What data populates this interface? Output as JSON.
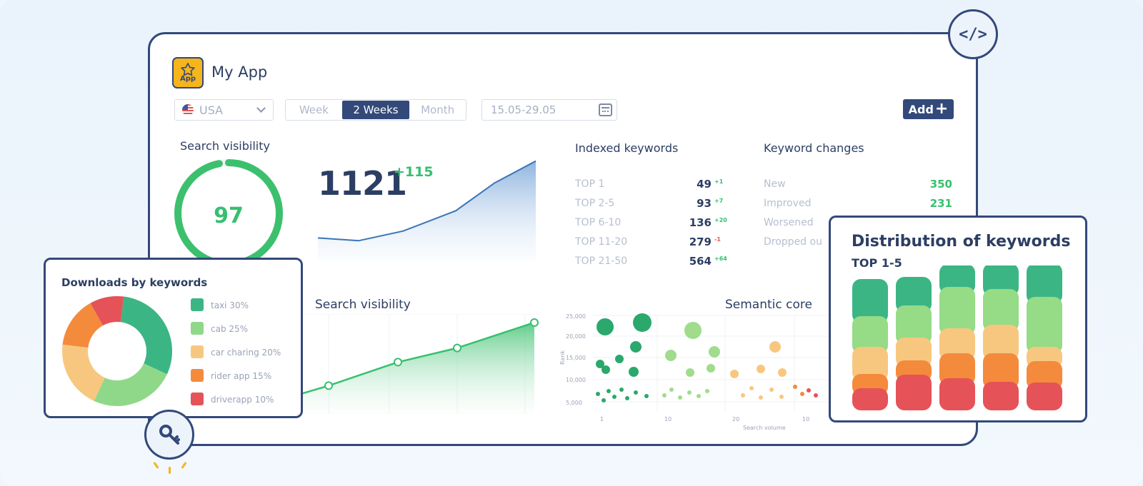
{
  "app": {
    "name": "My App",
    "icon_tag": "App",
    "icon": "star-icon"
  },
  "filters": {
    "country": "USA",
    "periods": [
      "Week",
      "2 Weeks",
      "Month"
    ],
    "active_period": "2 Weeks",
    "date_range": "15.05-29.05",
    "add_label": "Add"
  },
  "search_visibility": {
    "title": "Search visibility",
    "score": "97",
    "score_fraction": 0.97,
    "total": "1121",
    "delta": "+115",
    "trend": [
      40,
      35,
      52,
      68,
      88,
      137,
      176
    ]
  },
  "indexed_keywords": {
    "title": "Indexed keywords",
    "rows": [
      {
        "label": "TOP 1",
        "value": "49",
        "delta": "+1",
        "delta_color": "#36c06f"
      },
      {
        "label": "TOP 2-5",
        "value": "93",
        "delta": "+7",
        "delta_color": "#36c06f"
      },
      {
        "label": "TOP 6-10",
        "value": "136",
        "delta": "+20",
        "delta_color": "#36c06f"
      },
      {
        "label": "TOP 11-20",
        "value": "279",
        "delta": "-1",
        "delta_color": "#ef5350"
      },
      {
        "label": "TOP 21-50",
        "value": "564",
        "delta": "+64",
        "delta_color": "#36c06f"
      }
    ]
  },
  "keyword_changes": {
    "title": "Keyword changes",
    "rows": [
      {
        "label": "New",
        "value": "350"
      },
      {
        "label": "Improved",
        "value": "231"
      },
      {
        "label": "Worsened",
        "value": ""
      },
      {
        "label": "Dropped ou",
        "value": ""
      }
    ]
  },
  "visibility_chart": {
    "title": "Search visibility",
    "points": [
      0.12,
      0.3,
      0.55,
      0.7,
      0.97
    ]
  },
  "semantic_core": {
    "title": "Semantic core",
    "y_ticks": [
      "25,000",
      "20,000",
      "15,000",
      "10,000",
      "5,000"
    ],
    "x_ticks": [
      "1",
      "10",
      "20",
      "10"
    ],
    "ylabel": "Rank",
    "xlabel": "Search volume"
  },
  "downloads": {
    "title": "Downloads by keywords",
    "items": [
      {
        "label": "taxi 30%",
        "share": 30,
        "color": "#3cb585"
      },
      {
        "label": "cab 25%",
        "share": 25,
        "color": "#8fd88a"
      },
      {
        "label": "car charing 20%",
        "share": 20,
        "color": "#f8c77f"
      },
      {
        "label": "rider app 15%",
        "share": 15,
        "color": "#f48a3c"
      },
      {
        "label": "driverapp 10%",
        "share": 10,
        "color": "#e55258"
      }
    ]
  },
  "distribution": {
    "title": "Distribution of keywords",
    "subtitle": "TOP 1-5",
    "colors": [
      "#3cb585",
      "#96db86",
      "#f8c77f",
      "#f48a3c",
      "#e55258"
    ],
    "bars": [
      [
        52,
        43,
        38,
        20,
        21
      ],
      [
        40,
        45,
        32,
        20,
        40
      ],
      [
        32,
        58,
        35,
        35,
        35
      ],
      [
        36,
        50,
        40,
        40,
        30
      ],
      [
        47,
        70,
        20,
        30,
        29
      ]
    ]
  },
  "badges": {
    "code": "</>",
    "code_icon": "code-icon",
    "key_icon": "key-icon"
  }
}
